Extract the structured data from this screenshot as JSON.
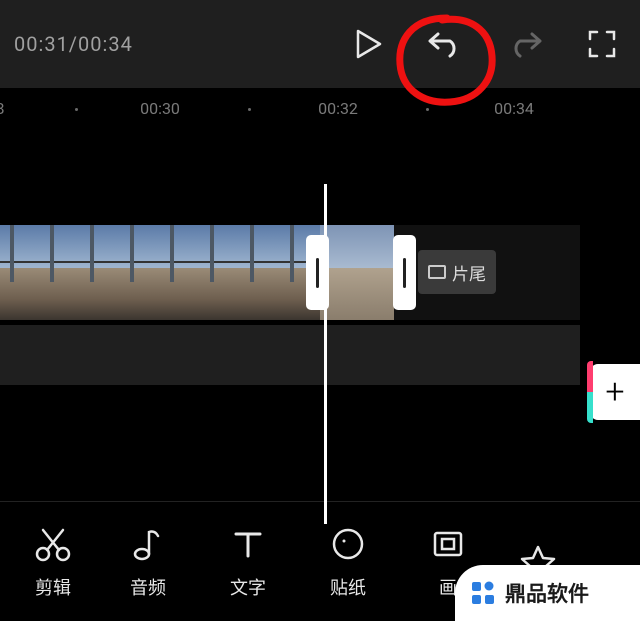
{
  "player": {
    "current_time": "00:31",
    "total_time": "00:34",
    "time_display": "00:31/00:34"
  },
  "ruler": {
    "labels": [
      "00:30",
      "00:32",
      "00:34"
    ]
  },
  "clip": {
    "end_badge": "片尾"
  },
  "toolbar": [
    {
      "id": "cut",
      "label": "剪辑"
    },
    {
      "id": "audio",
      "label": "音频"
    },
    {
      "id": "text",
      "label": "文字"
    },
    {
      "id": "sticker",
      "label": "贴纸"
    },
    {
      "id": "canvas",
      "label": "画"
    }
  ],
  "watermark": {
    "text": "鼎品软件"
  },
  "add_button": {
    "symbol": "+"
  }
}
